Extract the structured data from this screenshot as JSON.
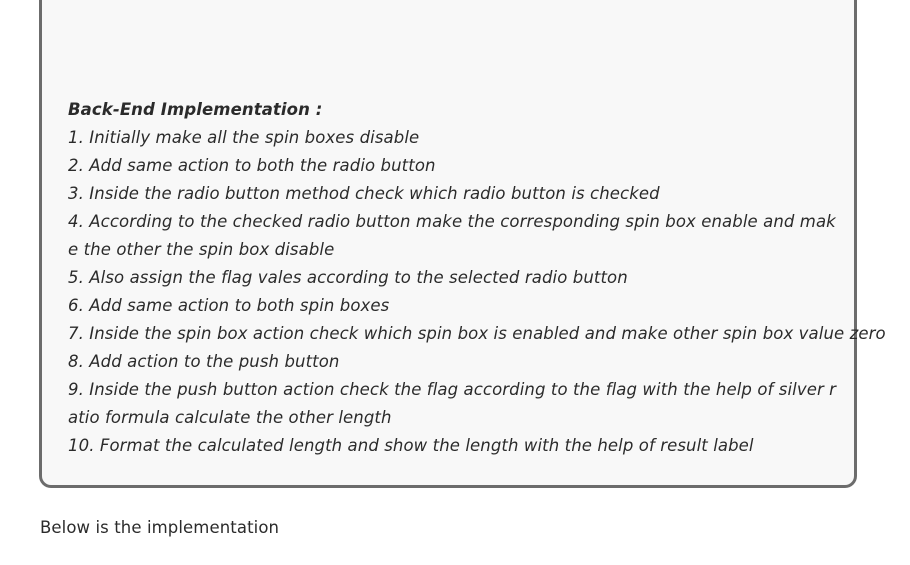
{
  "card": {
    "heading": "Back-End Implementation :",
    "steps": [
      "1. Initially make all the spin boxes disable",
      "2. Add same action to both the radio button",
      "3. Inside the radio button method check which radio button is checked",
      "4. According to the checked radio button make the corresponding spin box enable and make the other the spin box disable",
      "5. Also assign the flag vales according to the selected radio button",
      "6. Add same action to both spin boxes",
      "7. Inside the spin box action check which spin box is enabled and make other spin box value zero",
      "8. Add action to the push button",
      "9. Inside the push button action check the flag according to the flag with the help of silver ratio formula calculate the other length",
      "10. Format the calculated length and show the length with the help of result label"
    ]
  },
  "below_text": "Below is the implementation"
}
